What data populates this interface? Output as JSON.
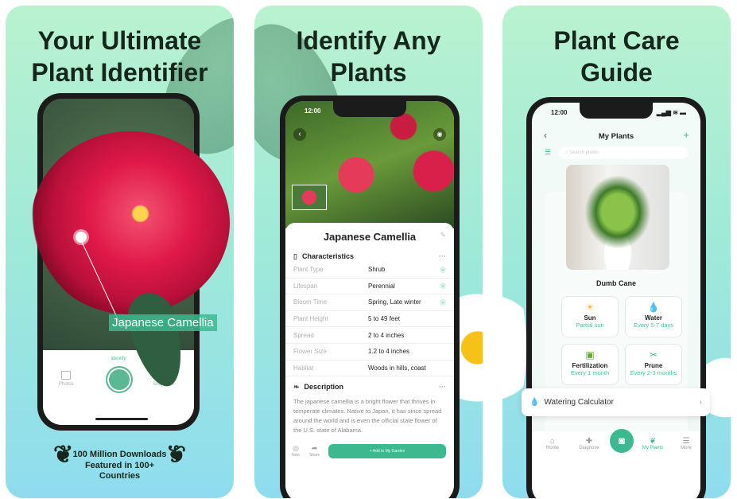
{
  "panels": [
    {
      "headline": [
        "Your Ultimate",
        "Plant Identifier"
      ],
      "tag_label": "Japanese Camellia",
      "camera": {
        "identify_label": "Identify",
        "photos_label": "Photos",
        "snap_tips_label": "Snap Tips"
      },
      "badge": [
        "100 Million Downloads",
        "Featured in 100+",
        "Countries"
      ]
    },
    {
      "headline": [
        "Identify Any",
        "Plants"
      ],
      "status_time": "12:00",
      "plant_name": "Japanese Camellia",
      "characteristics_title": "Characteristics",
      "characteristics": [
        {
          "label": "Plant Type",
          "value": "Shrub",
          "expandable": true
        },
        {
          "label": "Lifespan",
          "value": "Perennial",
          "expandable": true
        },
        {
          "label": "Bloom Time",
          "value": "Spring, Late winter",
          "expandable": true
        },
        {
          "label": "Plant Height",
          "value": "5 to 49 feet",
          "expandable": false
        },
        {
          "label": "Spread",
          "value": "2 to 4 inches",
          "expandable": false
        },
        {
          "label": "Flower Size",
          "value": "1.2 to 4 inches",
          "expandable": false
        },
        {
          "label": "Habitat",
          "value": "Woods in hills, coast",
          "expandable": false
        }
      ],
      "description_title": "Description",
      "description": "The japanese camellia is a bright flower that thrives in temperate climates. Native to Japan, it has since spread around the world and is even the official state flower of the U.S. state of Alabama.",
      "toolbar": {
        "new_label": "New",
        "share_label": "Share",
        "add_label": "+ Add to My Garden"
      }
    },
    {
      "headline": [
        "Plant Care",
        "Guide"
      ],
      "status_time": "12:00",
      "title": "My Plants",
      "search_placeholder": "Search plants",
      "plant_name": "Dumb Cane",
      "care": [
        {
          "title": "Sun",
          "value": "Partial sun",
          "icon": "sun-icon"
        },
        {
          "title": "Water",
          "value": "Every 5-7 days",
          "icon": "water-drop-icon"
        },
        {
          "title": "Fertilization",
          "value": "Every 1 month",
          "icon": "fertilizer-icon"
        },
        {
          "title": "Prune",
          "value": "Every 2-3 months",
          "icon": "scissors-icon"
        }
      ],
      "watering_calculator": "Watering Calculator",
      "nav": [
        {
          "label": "Home"
        },
        {
          "label": "Diagnose"
        },
        {
          "label": "My Plants",
          "active": true
        },
        {
          "label": "More"
        }
      ]
    }
  ],
  "colors": {
    "accent": "#3cb98f",
    "headline": "#16261c",
    "flower": "#e0194a"
  }
}
